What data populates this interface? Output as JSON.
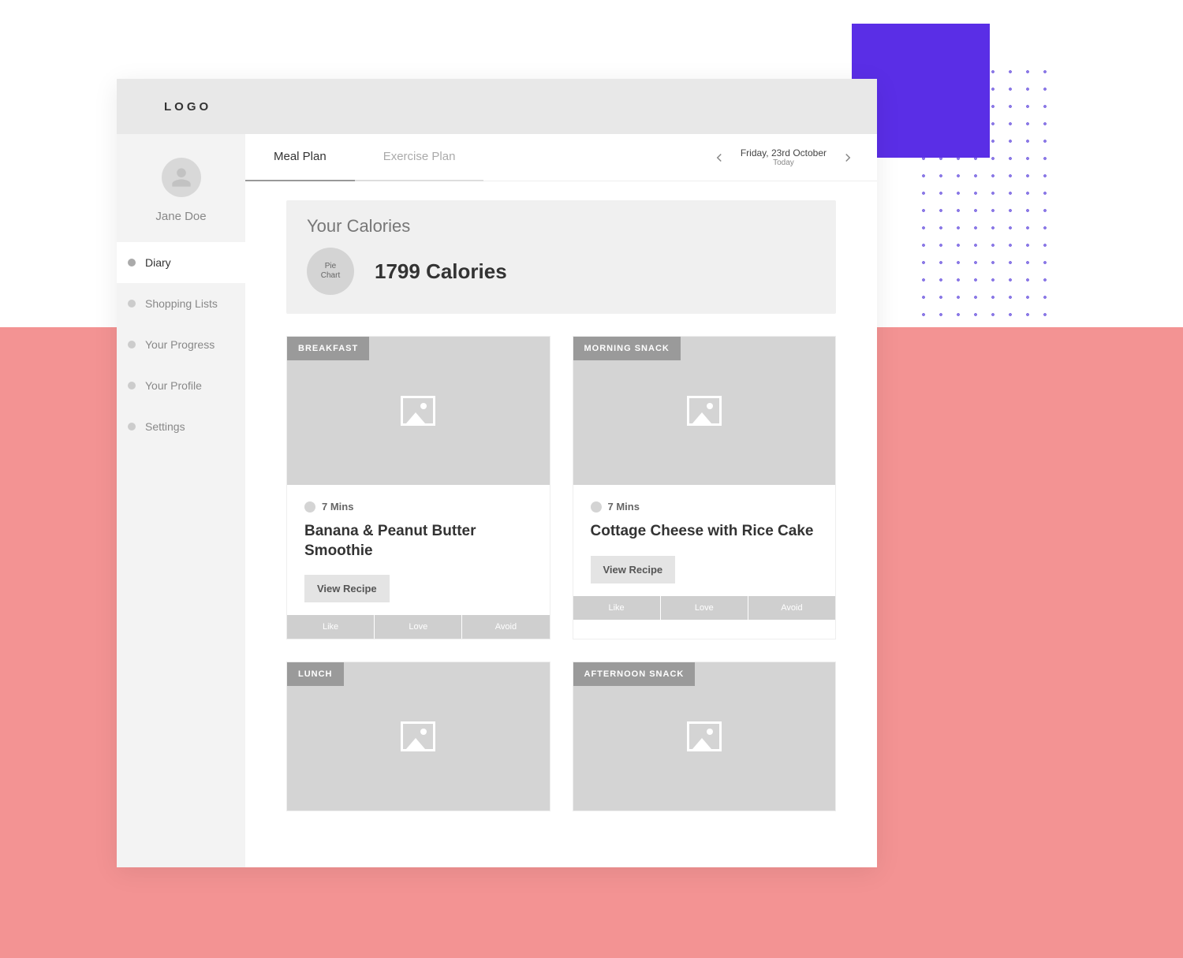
{
  "brand": {
    "logo": "LOGO"
  },
  "user": {
    "name": "Jane Doe"
  },
  "sidebar": {
    "items": [
      {
        "label": "Diary"
      },
      {
        "label": "Shopping Lists"
      },
      {
        "label": "Your Progress"
      },
      {
        "label": "Your Profile"
      },
      {
        "label": "Settings"
      }
    ]
  },
  "tabs": {
    "meal_plan": "Meal Plan",
    "exercise_plan": "Exercise Plan"
  },
  "date": {
    "full": "Friday, 23rd October",
    "sub": "Today"
  },
  "calories": {
    "heading": "Your Calories",
    "pie_label_1": "Pie",
    "pie_label_2": "Chart",
    "value": "1799 Calories"
  },
  "meal_actions": {
    "like": "Like",
    "love": "Love",
    "avoid": "Avoid"
  },
  "meals": [
    {
      "badge": "BREAKFAST",
      "time": "7 Mins",
      "title": "Banana & Peanut Butter Smoothie",
      "button": "View Recipe"
    },
    {
      "badge": "MORNING SNACK",
      "time": "7 Mins",
      "title": "Cottage Cheese with Rice Cake",
      "button": "View Recipe"
    },
    {
      "badge": "LUNCH",
      "time": "",
      "title": "",
      "button": ""
    },
    {
      "badge": "AFTERNOON SNACK",
      "time": "",
      "title": "",
      "button": ""
    }
  ]
}
